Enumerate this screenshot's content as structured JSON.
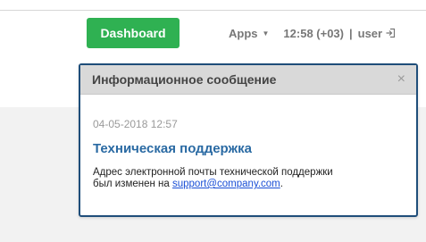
{
  "header": {
    "dashboard_label": "Dashboard",
    "apps_label": "Apps",
    "time": "12:58 (+03)",
    "separator": "|",
    "user_label": "user"
  },
  "message": {
    "title": "Информационное сообщение",
    "close_symbol": "×",
    "date": "04-05-2018 12:57",
    "subject": "Техническая поддержка",
    "text_line1": "Адрес электронной почты технической поддержки",
    "text_line2_prefix": "был изменен на ",
    "email": "support@company.com",
    "text_suffix": "."
  },
  "colors": {
    "dashboard_green": "#2fb152",
    "dialog_border": "#1f4e7a",
    "subject_blue": "#2a6aa3",
    "link_blue": "#1a4fd6"
  },
  "icons": {
    "apps_caret": "chevron-down-icon",
    "logout": "logout-icon",
    "close": "close-icon"
  }
}
